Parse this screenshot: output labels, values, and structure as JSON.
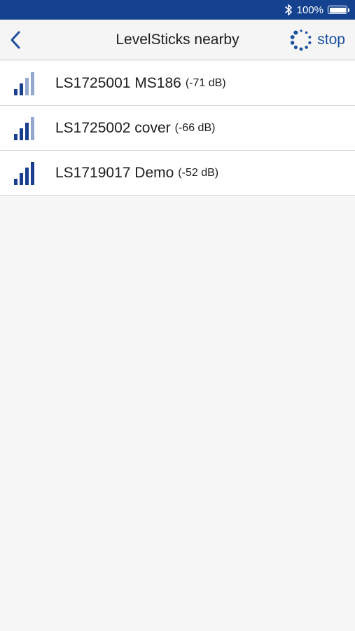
{
  "status_bar": {
    "battery_percent": "100%",
    "bluetooth_icon": "bluetooth-icon",
    "battery_icon": "battery-icon",
    "background": "#15428f"
  },
  "nav": {
    "title": "LevelSticks nearby",
    "back_icon": "chevron-left-icon",
    "stop_label": "stop",
    "spinner_icon": "spinner-icon",
    "accent": "#1b4fa0"
  },
  "devices": [
    {
      "name": "LS1725001 MS186",
      "rssi": "(-71 dB)",
      "signal_bars": 2
    },
    {
      "name": "LS1725002 cover",
      "rssi": "(-66 dB)",
      "signal_bars": 3
    },
    {
      "name": "LS1719017 Demo",
      "rssi": "(-52 dB)",
      "signal_bars": 4
    }
  ],
  "colors": {
    "bar_active": "#1b3f8f",
    "bar_inactive": "#93a7cf"
  }
}
